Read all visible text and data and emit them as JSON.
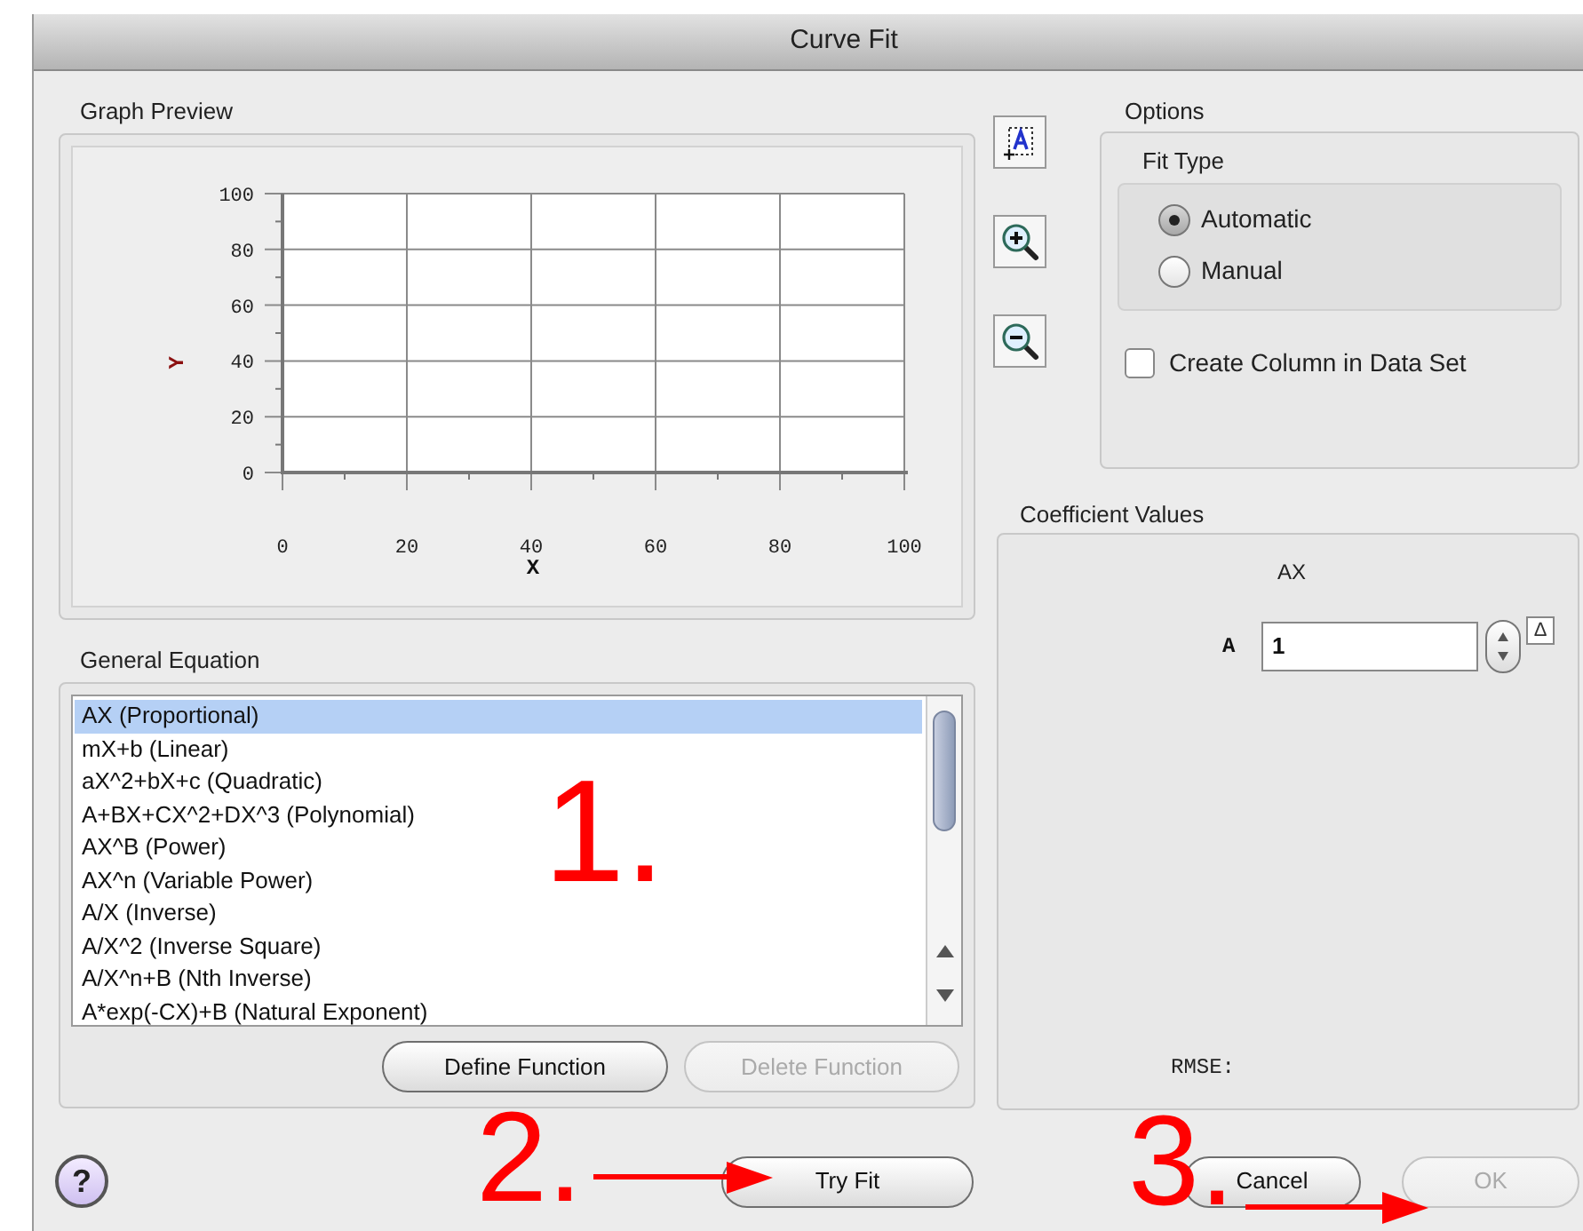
{
  "window": {
    "title": "Curve Fit"
  },
  "graph_preview": {
    "label": "Graph Preview",
    "chart_data": {
      "type": "line",
      "xlabel": "X",
      "ylabel": "Y",
      "xlim": [
        0,
        100
      ],
      "ylim": [
        0,
        100
      ],
      "xticks": [
        0,
        20,
        40,
        60,
        80,
        100
      ],
      "yticks": [
        0,
        20,
        40,
        60,
        80,
        100
      ],
      "grid": true
    }
  },
  "zoom_tools": [
    {
      "kind": "zoom_box"
    },
    {
      "kind": "zoom_in"
    },
    {
      "kind": "zoom_out"
    }
  ],
  "options": {
    "label": "Options",
    "fit_type": {
      "label": "Fit Type",
      "choices": [
        {
          "label": "Automatic",
          "selected": true
        },
        {
          "label": "Manual",
          "selected": false
        }
      ]
    },
    "create_column": {
      "label": "Create Column in Data Set",
      "checked": false
    }
  },
  "general_equation": {
    "label": "General Equation",
    "items": [
      {
        "label": "AX (Proportional)",
        "selected": true
      },
      {
        "label": "mX+b (Linear)",
        "selected": false
      },
      {
        "label": "aX^2+bX+c (Quadratic)",
        "selected": false
      },
      {
        "label": "A+BX+CX^2+DX^3 (Polynomial)",
        "selected": false
      },
      {
        "label": "AX^B (Power)",
        "selected": false
      },
      {
        "label": "AX^n (Variable Power)",
        "selected": false
      },
      {
        "label": "A/X (Inverse)",
        "selected": false
      },
      {
        "label": "A/X^2 (Inverse Square)",
        "selected": false
      },
      {
        "label": "A/X^n+B (Nth Inverse)",
        "selected": false
      },
      {
        "label": "A*exp(-CX)+B (Natural Exponent)",
        "selected": false
      }
    ],
    "buttons": [
      {
        "label": "Define Function",
        "disabled": false
      },
      {
        "label": "Delete Function",
        "disabled": true
      }
    ]
  },
  "coefficient_values": {
    "label": "Coefficient Values",
    "equation": "AX",
    "coefficients": [
      {
        "name": "A",
        "value": "1",
        "delta": "Δ"
      }
    ],
    "rmse_label": "RMSE:"
  },
  "help_button": {
    "label": "?"
  },
  "buttons": [
    {
      "label": "Try Fit",
      "disabled": false
    },
    {
      "label": "Cancel",
      "disabled": false
    },
    {
      "label": "OK",
      "disabled": true
    }
  ],
  "annotations": [
    {
      "label": "1.",
      "arrow": false
    },
    {
      "label": "2.",
      "arrow": true
    },
    {
      "label": "3.",
      "arrow": true
    }
  ]
}
